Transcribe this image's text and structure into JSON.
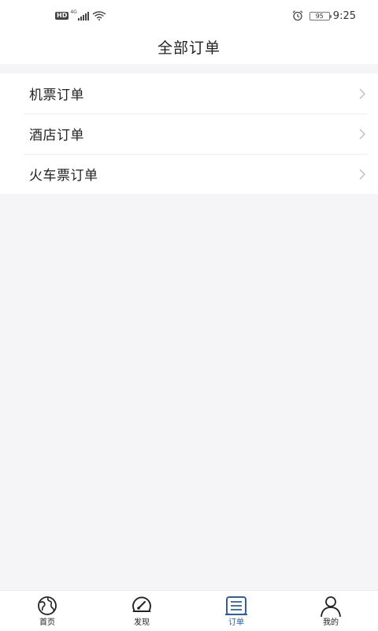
{
  "status_bar": {
    "hd": "HD",
    "network": "4G",
    "battery": "95",
    "time": "9:25"
  },
  "header": {
    "title": "全部订单"
  },
  "orders": [
    {
      "label": "机票订单"
    },
    {
      "label": "酒店订单"
    },
    {
      "label": "火车票订单"
    }
  ],
  "tab_bar": {
    "tabs": [
      {
        "label": "首页",
        "icon": "globe-icon",
        "active": false
      },
      {
        "label": "发现",
        "icon": "compass-icon",
        "active": false
      },
      {
        "label": "订单",
        "icon": "order-list-icon",
        "active": true
      },
      {
        "label": "我的",
        "icon": "user-icon",
        "active": false
      }
    ]
  },
  "colors": {
    "accent": "#2f5fa0",
    "background": "#f5f4f7",
    "surface": "#ffffff",
    "text": "#222222",
    "chevron": "#bbbbbb"
  }
}
